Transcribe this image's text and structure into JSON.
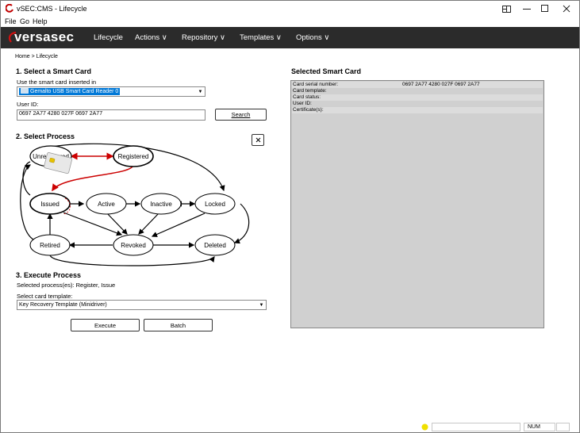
{
  "window": {
    "title": "vSEC:CMS - Lifecycle",
    "controls": [
      "snap-layout",
      "minimize",
      "maximize",
      "close"
    ]
  },
  "menu": {
    "items": [
      "File",
      "Go",
      "Help"
    ]
  },
  "navbar": {
    "logo_text": "versasec",
    "items": [
      "Lifecycle",
      "Actions ∨",
      "Repository ∨",
      "Templates ∨",
      "Options ∨"
    ]
  },
  "breadcrumb": "Home > Lifecycle",
  "step1": {
    "heading": "1. Select a Smart Card",
    "reader_label": "Use the smart card inserted in",
    "reader_value": "Gemalto USB Smart Card Reader 0",
    "userid_label": "User ID:",
    "userid_value": "0697 2A77 4280 027F 0697 2A77",
    "search_label": "Search"
  },
  "step2": {
    "heading": "2. Select Process",
    "reset_icon": "close-icon",
    "states": {
      "unregistered": "Unregistered",
      "registered": "Registered",
      "issued": "Issued",
      "active": "Active",
      "inactive": "Inactive",
      "locked": "Locked",
      "retired": "Retired",
      "revoked": "Revoked",
      "deleted": "Deleted"
    },
    "colors": {
      "highlight": "#cc0000",
      "card": "#e8e8e8",
      "chip": "#e6c200"
    }
  },
  "step3": {
    "heading": "3. Execute Process",
    "selected_processes": "Selected process(es): Register, Issue",
    "template_label": "Select card template:",
    "template_value": "Key Recovery Template (Minidriver)",
    "execute_label": "Execute",
    "batch_label": "Batch"
  },
  "selected_card": {
    "heading": "Selected Smart Card",
    "rows": [
      {
        "label": "Card serial number:",
        "value": "0697 2A77 4280 027F 0697 2A77"
      },
      {
        "label": "Card template:",
        "value": ""
      },
      {
        "label": "Card status:",
        "value": ""
      },
      {
        "label": "User ID:",
        "value": ""
      },
      {
        "label": "Certificate(s):",
        "value": ""
      }
    ]
  },
  "statusbar": {
    "indicator_color": "#f0e000",
    "num": "NUM"
  }
}
